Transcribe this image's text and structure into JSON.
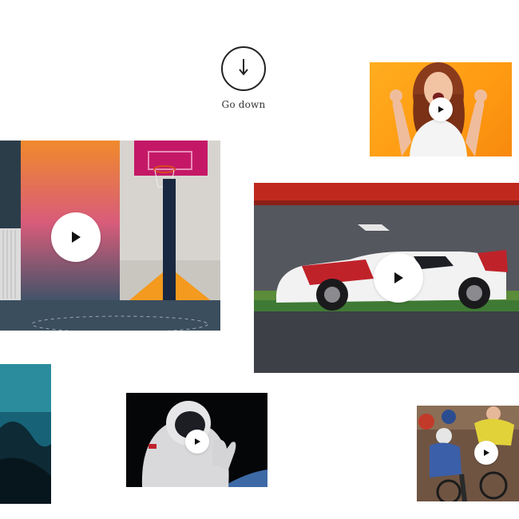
{
  "scroll_cue": {
    "label": "Go down",
    "icon": "arrow-down-icon"
  },
  "videos": [
    {
      "id": "excited-woman",
      "icon": "play-icon"
    },
    {
      "id": "basketball-court",
      "icon": "play-icon"
    },
    {
      "id": "race-car",
      "icon": "play-icon"
    },
    {
      "id": "underwater",
      "icon": "play-icon"
    },
    {
      "id": "astronaut",
      "icon": "play-icon"
    },
    {
      "id": "cyclists",
      "icon": "play-icon"
    }
  ],
  "colors": {
    "background": "#ffffff",
    "text": "#333333",
    "woman_bg": "#ff9f17",
    "play_button": "#ffffff"
  }
}
